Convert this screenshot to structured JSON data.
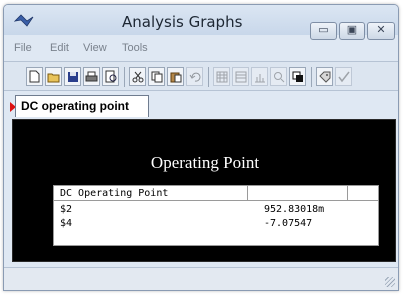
{
  "window": {
    "title": "Analysis Graphs",
    "controls": {
      "minimize": "▭",
      "maximize": "▣",
      "close": "✕"
    }
  },
  "menu": [
    "File",
    "Edit",
    "View",
    "Tools"
  ],
  "toolbar": {
    "buttons": [
      "new-icon",
      "open-icon",
      "save-icon",
      "print-icon",
      "print-preview-icon",
      "cut-icon",
      "copy-icon",
      "paste-icon",
      "undo-icon",
      "grid-icon",
      "table-icon",
      "chart-icon",
      "zoom-icon",
      "copy-window-icon",
      "tag-icon",
      "check-icon"
    ]
  },
  "tab": {
    "label": "DC operating point"
  },
  "graph": {
    "title": "Operating Point",
    "table": {
      "header": "DC Operating Point",
      "rows": [
        {
          "name": "$2",
          "value": "952.83018m"
        },
        {
          "name": "$4",
          "value": "-7.07547"
        }
      ]
    }
  },
  "colors": {
    "graph_background": "#000000",
    "tab_marker": "#dd1111"
  }
}
